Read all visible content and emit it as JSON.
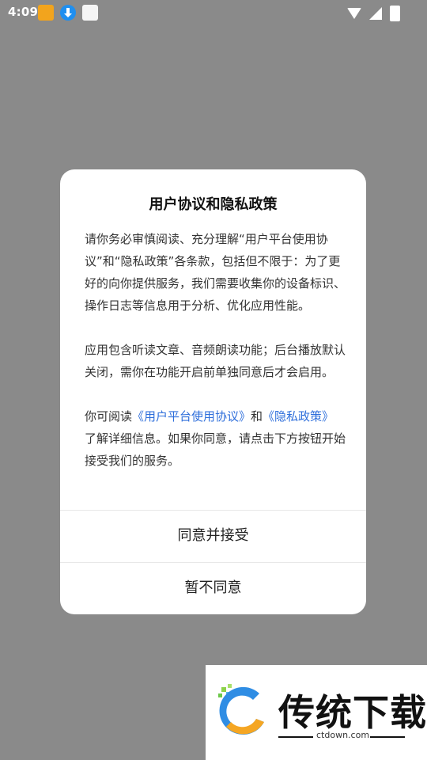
{
  "status_bar": {
    "time": "4:09",
    "left_icons": [
      "app-notification-icon",
      "download-icon",
      "app-icon"
    ],
    "right_icons": [
      "wifi-icon",
      "signal-icon",
      "battery-charging-icon"
    ]
  },
  "dialog": {
    "title": "用户协议和隐私政策",
    "para1": "请你务必审慎阅读、充分理解“用户平台使用协议”和“隐私政策”各条款，包括但不限于：为了更好的向你提供服务，我们需要收集你的设备标识、操作日志等信息用于分析、优化应用性能。",
    "para2": "应用包含听读文章、音频朗读功能；后台播放默认关闭，需你在功能开启前单独同意后才会启用。",
    "para3_prefix": "你可阅读",
    "para3_link1": "《用户平台使用协议》",
    "para3_and": "和",
    "para3_link2": "《隐私政策》",
    "para3_suffix": "了解详细信息。如果你同意，请点击下方按钮开始接受我们的服务。",
    "accept_label": "同意并接受",
    "decline_label": "暂不同意",
    "link_color": "#2f6fdb"
  },
  "watermark": {
    "text": "传统下载",
    "url": "ctdown.com"
  }
}
